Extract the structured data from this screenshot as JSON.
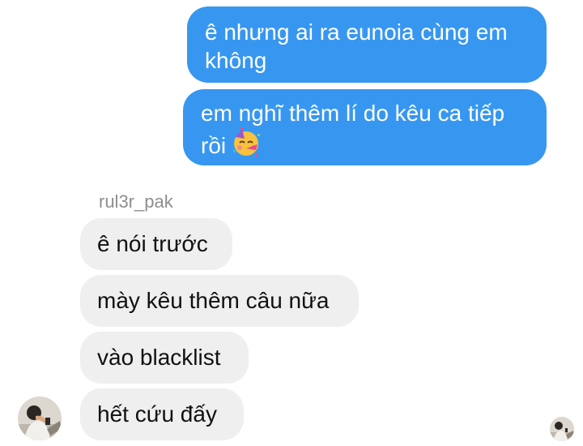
{
  "conversation": {
    "sent_messages": [
      {
        "text": "ê nhưng ai ra eunoia cùng em\nkhông"
      },
      {
        "text": "em nghĩ thêm lí do kêu ca tiếp\nrồi",
        "emoji": "partying-face-emoji"
      }
    ],
    "sender_name": "rul3r_pak",
    "received_messages": [
      {
        "text": "ê nói trước"
      },
      {
        "text": "mày kêu thêm câu nữa"
      },
      {
        "text": "vào blacklist"
      },
      {
        "text": "hết cứu đấy"
      }
    ]
  },
  "colors": {
    "sent_bubble": "#3797f0",
    "received_bubble": "#efefef",
    "sender_name": "#8e8e8e"
  }
}
